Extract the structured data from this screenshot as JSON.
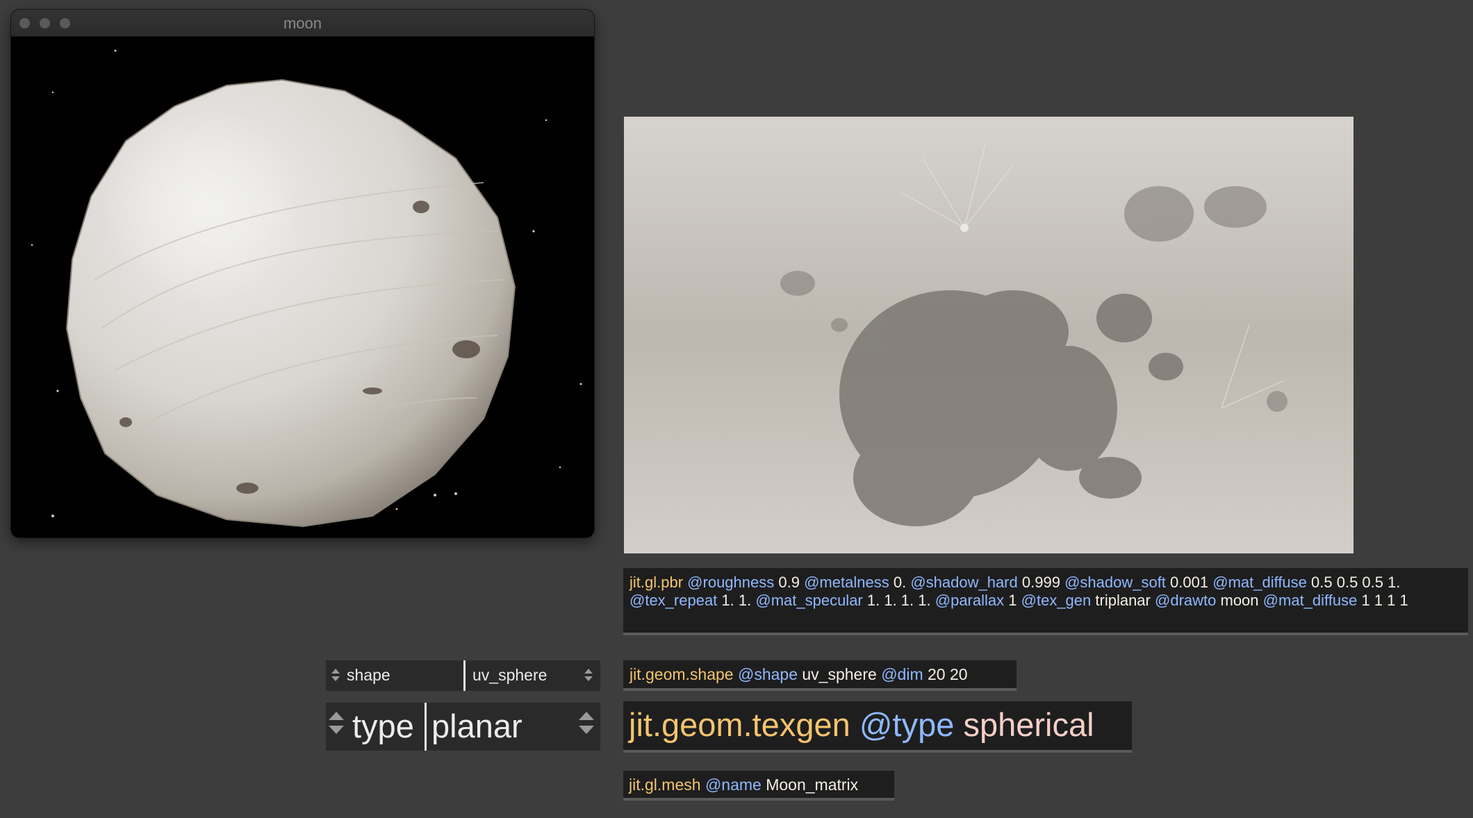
{
  "window": {
    "title": "moon"
  },
  "texture_map": {
    "alt": "moon texture map"
  },
  "objects": {
    "pbr": {
      "name": "jit.gl.pbr",
      "attrs": [
        {
          "attr": "@roughness",
          "value": "0.9"
        },
        {
          "attr": "@metalness",
          "value": "0."
        },
        {
          "attr": "@shadow_hard",
          "value": "0.999"
        },
        {
          "attr": "@shadow_soft",
          "value": "0.001"
        },
        {
          "attr": "@mat_diffuse",
          "value": "0.5 0.5 0.5 1."
        },
        {
          "attr": "@tex_repeat",
          "value": "1. 1."
        },
        {
          "attr": "@mat_specular",
          "value": "1. 1. 1. 1."
        },
        {
          "attr": "@parallax",
          "value": "1"
        },
        {
          "attr": "@tex_gen",
          "value": "triplanar"
        },
        {
          "attr": "@drawto",
          "value": "moon"
        },
        {
          "attr": "@mat_diffuse",
          "value": "1 1 1 1"
        }
      ]
    },
    "shape": {
      "name": "jit.geom.shape",
      "attr1": "@shape",
      "val1": "uv_sphere",
      "attr2": "@dim",
      "val2": "20 20"
    },
    "texgen": {
      "name": "jit.geom.texgen",
      "attr": "@type",
      "value": "spherical"
    },
    "mesh": {
      "name": "jit.gl.mesh",
      "attr": "@name",
      "value": "Moon_matrix"
    }
  },
  "menus": {
    "shape": {
      "label": "shape",
      "selected": "uv_sphere"
    },
    "type": {
      "label": "type",
      "selected": "planar"
    }
  },
  "colors": {
    "object_name": "#f3c46d",
    "attribute": "#8fb8ff",
    "background": "#3d3d3d"
  }
}
